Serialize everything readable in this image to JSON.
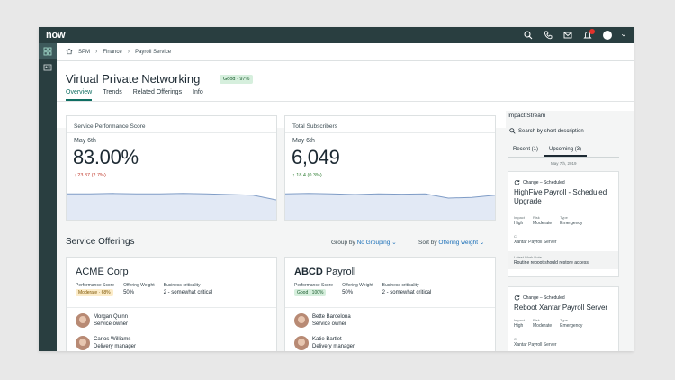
{
  "app": {
    "logo": "now",
    "notifications_count": "1"
  },
  "breadcrumb": {
    "home": "SPM",
    "items": [
      "Finance",
      "Payroll Service"
    ]
  },
  "header": {
    "title": "Virtual Private Networking",
    "status": "Good · 97%",
    "tabs": [
      {
        "label": "Overview",
        "active": true
      },
      {
        "label": "Trends",
        "active": false
      },
      {
        "label": "Related Offerings",
        "active": false
      },
      {
        "label": "Info",
        "active": false
      }
    ]
  },
  "metrics": [
    {
      "label": "Service Performance Score",
      "date": "May 6th",
      "value": "83.00%",
      "delta": "23.87 (2.7%)",
      "direction": "down",
      "trend": [
        0.72,
        0.72,
        0.73,
        0.72,
        0.72,
        0.73,
        0.72,
        0.7,
        0.68,
        0.55
      ]
    },
    {
      "label": "Total Subscribers",
      "date": "May 6th",
      "value": "6,049",
      "delta": "18.4 (0.3%)",
      "direction": "up",
      "trend": [
        0.72,
        0.73,
        0.72,
        0.7,
        0.72,
        0.71,
        0.72,
        0.6,
        0.62,
        0.68
      ]
    }
  ],
  "offerings": {
    "title": "Service Offerings",
    "group_by_label": "Group by",
    "group_by_value": "No Grouping",
    "sort_by_label": "Sort by",
    "sort_by_value": "Offering weight",
    "cards": [
      {
        "name": "ACME Corp",
        "perf_label": "Performance Score",
        "perf_value": "Moderate · 68%",
        "perf_level": "moderate",
        "weight_label": "Offering Weight",
        "weight_value": "50%",
        "crit_label": "Business criticality",
        "crit_value": "2 - somewhat critical",
        "people": [
          {
            "name": "Morgan Quinn",
            "role": "Service owner"
          },
          {
            "name": "Carlos Williams",
            "role": "Delivery manager"
          }
        ]
      },
      {
        "name_bold": "ABCD",
        "name_rest": " Payroll",
        "perf_label": "Performance Score",
        "perf_value": "Good · 100%",
        "perf_level": "good",
        "weight_label": "Offering Weight",
        "weight_value": "50%",
        "crit_label": "Business criticality",
        "crit_value": "2 - somewhat critical",
        "people": [
          {
            "name": "Bette Barcelona",
            "role": "Service owner"
          },
          {
            "name": "Katie Bartlet",
            "role": "Delivery manager"
          }
        ]
      }
    ]
  },
  "impact_stream": {
    "title": "Impact Stream",
    "search_placeholder": "Search by short description",
    "tabs": [
      {
        "label": "Recent (1)",
        "active": false
      },
      {
        "label": "Upcoming (3)",
        "active": true
      }
    ],
    "date": "May 7th, 2019",
    "cards": [
      {
        "type": "Change – Scheduled",
        "title": "HighFive Payroll - Scheduled Upgrade",
        "impact_label": "Impact",
        "impact": "High",
        "risk_label": "Risk",
        "risk": "Moderate",
        "type_label": "Type",
        "type_value": "Emergency",
        "ci_label": "CI",
        "ci": "Xantar Payroll Server",
        "note_label": "Latest Work Note",
        "note": "Routine reboot should restore access"
      },
      {
        "type": "Change – Scheduled",
        "title": "Reboot Xantar Payroll Server",
        "impact_label": "Impact",
        "impact": "High",
        "risk_label": "Risk",
        "risk": "Moderate",
        "type_label": "Type",
        "type_value": "Emergency",
        "ci_label": "CI",
        "ci": "Xantar Payroll Server"
      }
    ]
  }
}
